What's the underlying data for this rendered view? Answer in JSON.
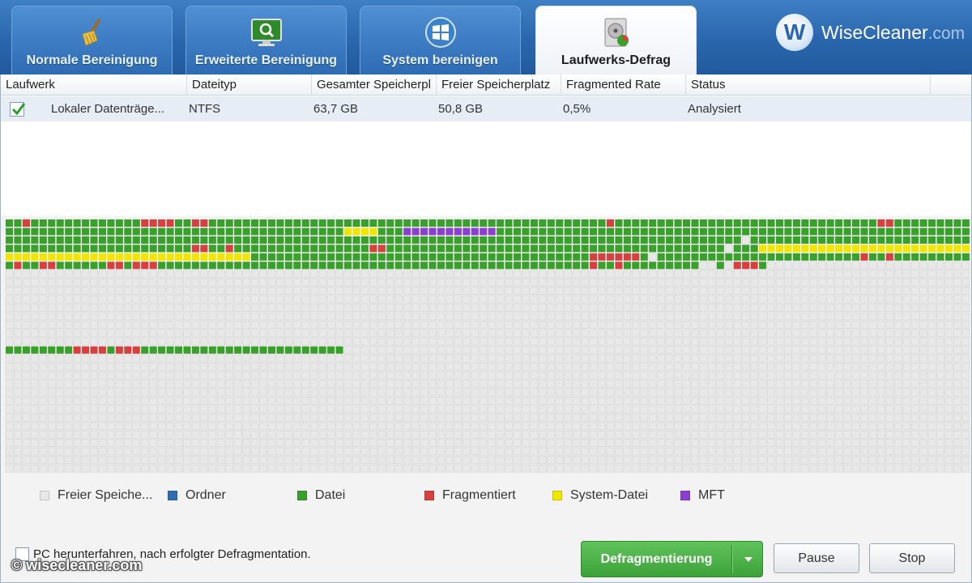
{
  "tabs": [
    {
      "label": "Normale Bereinigung",
      "icon": "broom-icon",
      "active": false
    },
    {
      "label": "Erweiterte Bereinigung",
      "icon": "monitor-search-icon",
      "active": false
    },
    {
      "label": "System bereinigen",
      "icon": "windows-logo-icon",
      "active": false
    },
    {
      "label": "Laufwerks-Defrag",
      "icon": "disk-defrag-icon",
      "active": true
    }
  ],
  "brand": {
    "initial": "W",
    "name": "WiseCleaner",
    "domain": ".com"
  },
  "table": {
    "headers": [
      "Laufwerk",
      "Dateityp",
      "Gesamter Speicherpl",
      "Freier Speicherplatz",
      "Fragmented Rate",
      "Status"
    ],
    "rows": [
      {
        "checked": true,
        "drive": "Lokaler Datenträge...",
        "filesystem": "NTFS",
        "total": "63,7 GB",
        "free": "50,8 GB",
        "rate": "0,5%",
        "status": "Analysiert"
      }
    ]
  },
  "colors": {
    "free": "#e8e8e8",
    "folder": "#2e6db4",
    "file": "#3aa02c",
    "fragmented": "#d6403e",
    "system": "#f2e500",
    "mft": "#8a3fd1"
  },
  "legend": [
    {
      "label": "Freier Speiche...",
      "color": "#e8e8e8"
    },
    {
      "label": "Ordner",
      "color": "#2e6db4"
    },
    {
      "label": "Datei",
      "color": "#3aa02c"
    },
    {
      "label": "Fragmentiert",
      "color": "#d6403e"
    },
    {
      "label": "System-Datei",
      "color": "#f2e500"
    },
    {
      "label": "MFT",
      "color": "#8a3fd1"
    }
  ],
  "footer": {
    "shutdown_label": "PC herunterfahren, nach erfolgter Defragmentation.",
    "shutdown_checked": false,
    "defrag_label": "Defragmentierung",
    "pause_label": "Pause",
    "stop_label": "Stop"
  },
  "watermark": "© wisecleaner.com"
}
